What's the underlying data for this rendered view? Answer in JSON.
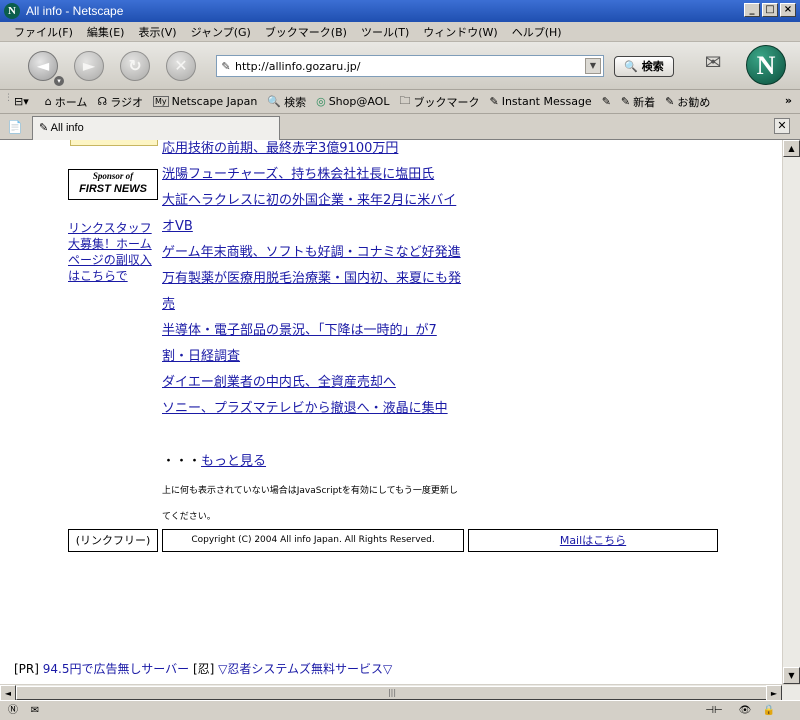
{
  "window": {
    "title": "All info - Netscape"
  },
  "menu": [
    "ファイル(F)",
    "編集(E)",
    "表示(V)",
    "ジャンプ(G)",
    "ブックマーク(B)",
    "ツール(T)",
    "ウィンドウ(W)",
    "ヘルプ(H)"
  ],
  "nav": {
    "url": "http://allinfo.gozaru.jp/",
    "search_label": "検索"
  },
  "personal_toolbar": {
    "items": [
      "ホーム",
      "ラジオ",
      "Netscape Japan",
      "検索",
      "Shop@AOL",
      "ブックマーク",
      "Instant Message",
      "",
      "新着",
      "お勧め"
    ],
    "overflow": "»"
  },
  "tab": {
    "label": "All info"
  },
  "page": {
    "sponsor_line1": "Sponsor of",
    "sponsor_line2": "FIRST NEWS",
    "side_link": "リンクスタッフ大募集！ホームページの副収入はこちらで",
    "news": [
      "応用技術の前期、最終赤字3億9100万円",
      "洸陽フューチャーズ、持ち株会社社長に塩田氏",
      "大証ヘラクレスに初の外国企業・来年2月に米バイオVB",
      "ゲーム年末商戦、ソフトも好調・コナミなど好発進",
      "万有製薬が医療用脱毛治療薬・国内初、来夏にも発売",
      "半導体・電子部品の景況、「下降は一時的」が7割・日経調査",
      "ダイエー創業者の中内氏、全資産売却へ",
      "ソニー、プラズマテレビから撤退へ・液晶に集中"
    ],
    "more_prefix": "・・・",
    "more_link": "もっと見る",
    "js_note": "上に何も表示されていない場合はJavaScriptを有効にしてもう一度更新してください。",
    "footer": {
      "link_free": "(リンクフリー)",
      "copyright": "Copyright (C) 2004 All info Japan. All Rights Reserved.",
      "mail": "Mailはこちら"
    },
    "pr": {
      "prefix": "[PR]",
      "ad1": "94.5円で広告無しサーバー",
      "ninja": "[忍]",
      "ad2": "▽忍者システムズ無料サービス▽"
    }
  }
}
